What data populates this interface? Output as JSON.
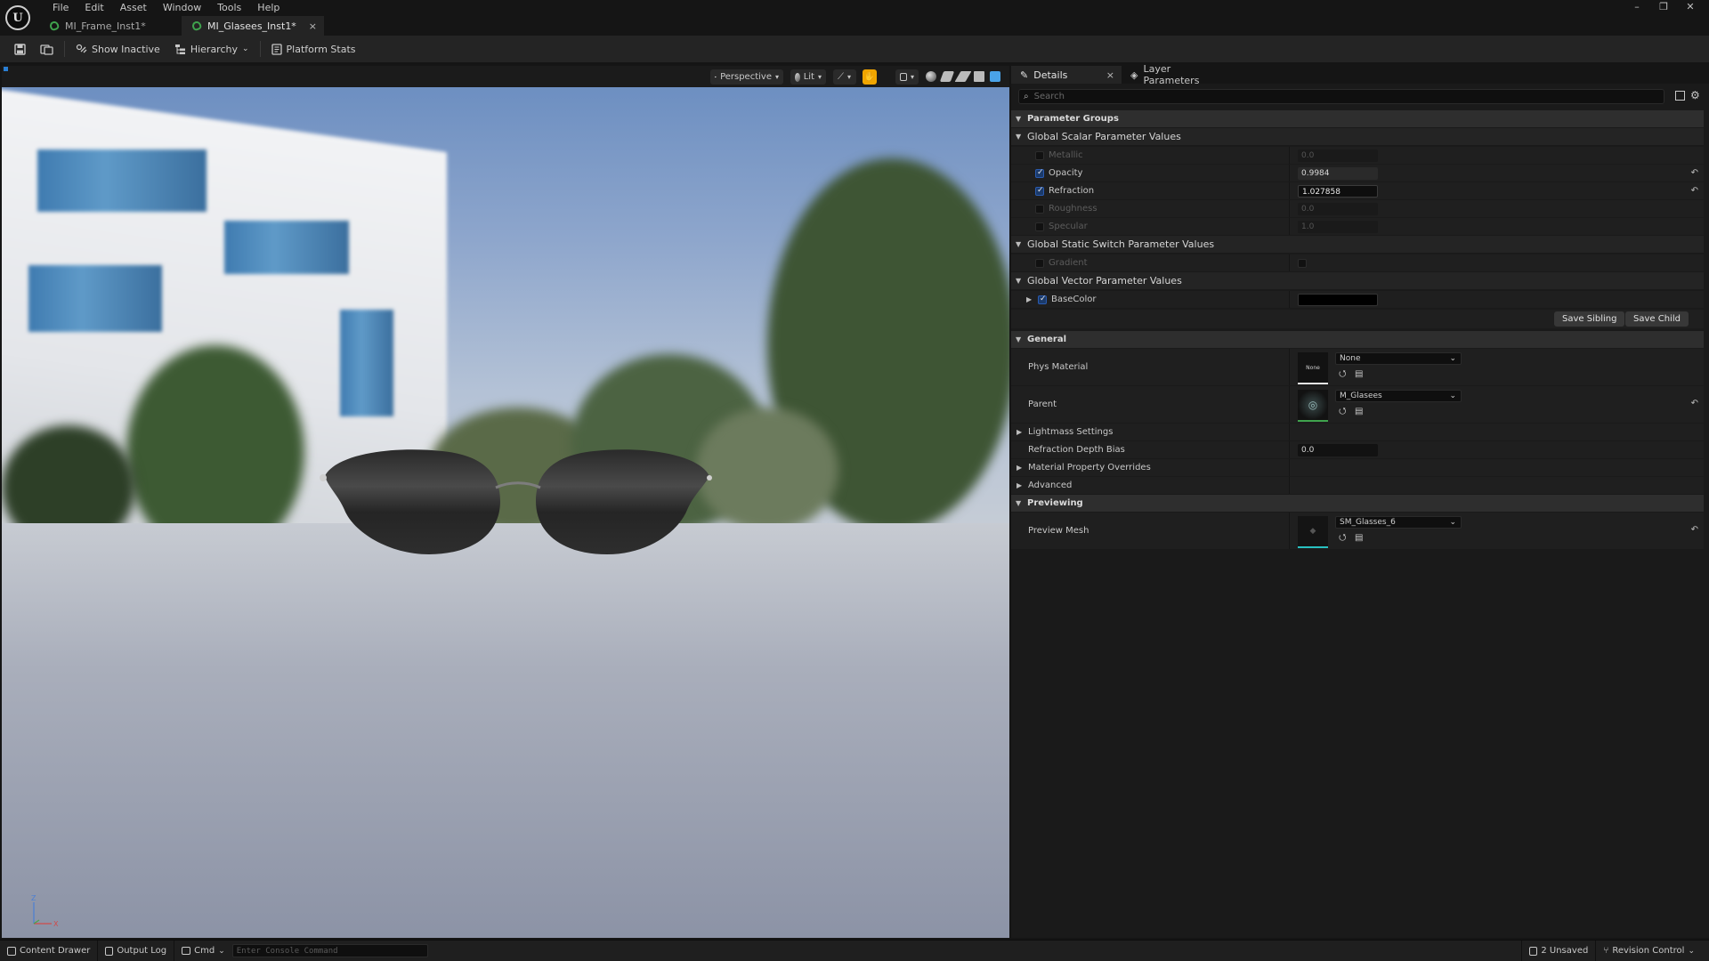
{
  "app": {
    "logo": "U",
    "menu": [
      "File",
      "Edit",
      "Asset",
      "Window",
      "Tools",
      "Help"
    ],
    "window_controls": {
      "minimize": "–",
      "restore": "❐",
      "close": "✕"
    },
    "tabs": [
      {
        "label": "MI_Frame_Inst1*",
        "active": false
      },
      {
        "label": "MI_Glasees_Inst1*",
        "active": true,
        "close": "×"
      }
    ]
  },
  "toolbar": {
    "show_inactive": "Show Inactive",
    "hierarchy": "Hierarchy",
    "platform_stats": "Platform Stats"
  },
  "viewport": {
    "perspective": "Perspective",
    "lit": "Lit",
    "axis": {
      "z": "Z",
      "x": "X"
    }
  },
  "details": {
    "tabs": {
      "details": "Details",
      "close": "×",
      "layer_parameters": "Layer Parameters"
    },
    "search_placeholder": "Search",
    "parameter_groups": "Parameter Groups",
    "global_scalar": "Global Scalar Parameter Values",
    "scalars": [
      {
        "name": "Metallic",
        "value": "0.0",
        "enabled": false
      },
      {
        "name": "Opacity",
        "value": "0.9984",
        "enabled": true
      },
      {
        "name": "Refraction",
        "value": "1.027858",
        "enabled": true
      },
      {
        "name": "Roughness",
        "value": "0.0",
        "enabled": false
      },
      {
        "name": "Specular",
        "value": "1.0",
        "enabled": false
      }
    ],
    "global_static_switch": "Global Static Switch Parameter Values",
    "switch_gradient": "Gradient",
    "global_vector": "Global Vector Parameter Values",
    "vector_basecolor": "BaseColor",
    "basecolor_hex": "#000000",
    "save_sibling": "Save Sibling",
    "save_child": "Save Child",
    "general": "General",
    "phys_material": {
      "label": "Phys Material",
      "thumb": "None",
      "value": "None"
    },
    "parent": {
      "label": "Parent",
      "value": "M_Glasees"
    },
    "lightmass": "Lightmass Settings",
    "refraction_depth_bias": {
      "label": "Refraction Depth Bias",
      "value": "0.0"
    },
    "material_property_overrides": "Material Property Overrides",
    "advanced": "Advanced",
    "previewing": "Previewing",
    "preview_mesh": {
      "label": "Preview Mesh",
      "value": "SM_Glasses_6"
    },
    "reset_icon": "↶"
  },
  "status": {
    "content_drawer": "Content Drawer",
    "output_log": "Output Log",
    "cmd": "Cmd",
    "console_placeholder": "Enter Console Command",
    "unsaved": "2 Unsaved",
    "revision_control": "Revision Control"
  },
  "colors": {
    "accent": "#2a5bb0",
    "brand_green": "#3fa34d",
    "highlight": "#f0a500"
  }
}
